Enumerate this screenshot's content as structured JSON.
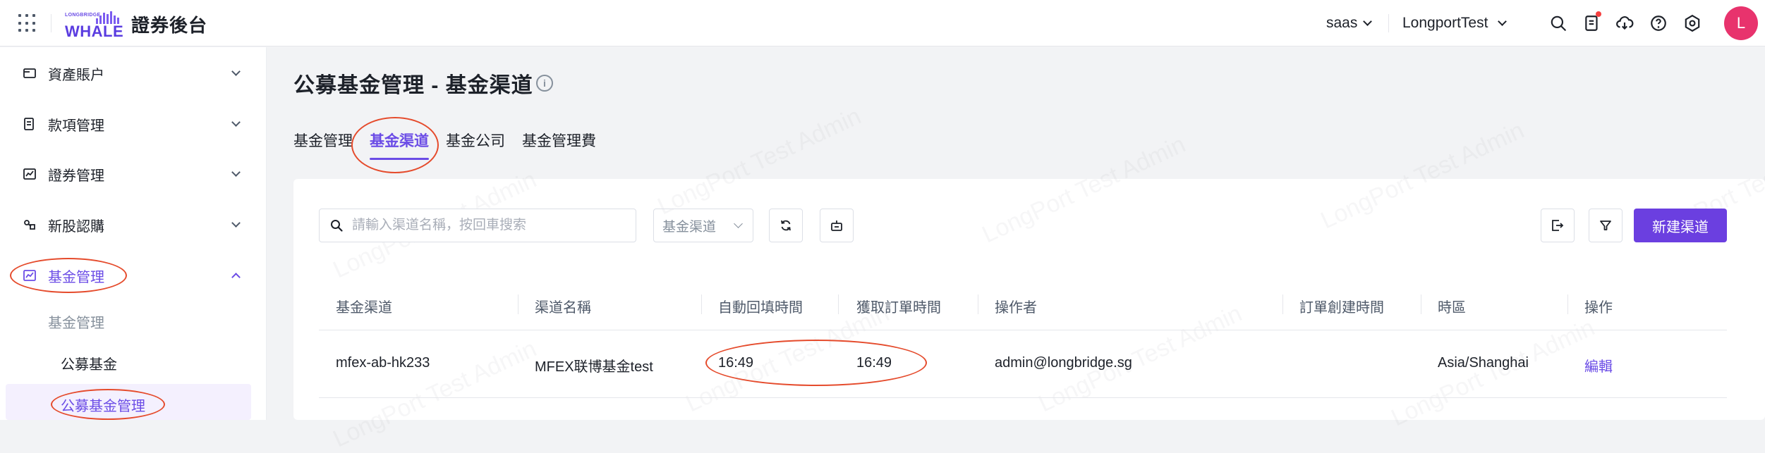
{
  "app": {
    "logo_small": "LONGBRIDGE",
    "logo_big": "WHALE",
    "title": "證券後台"
  },
  "topbar": {
    "env_label": "saas",
    "account_label": "LongportTest",
    "avatar_initial": "L"
  },
  "sidebar": {
    "items": [
      {
        "label": "資產賬户",
        "icon": "wallet-icon"
      },
      {
        "label": "款項管理",
        "icon": "document-icon"
      },
      {
        "label": "證券管理",
        "icon": "chart-icon"
      },
      {
        "label": "新股認購",
        "icon": "ipo-icon"
      },
      {
        "label": "基金管理",
        "icon": "fund-chart-icon"
      }
    ],
    "sub_group": "基金管理",
    "sub_items": [
      "公募基金",
      "公募基金管理"
    ]
  },
  "page": {
    "title": "公募基金管理 - 基金渠道",
    "tabs": [
      "基金管理",
      "基金渠道",
      "基金公司",
      "基金管理費"
    ],
    "active_tab": "基金渠道"
  },
  "toolbar": {
    "search_placeholder": "請輸入渠道名稱，按回車搜索",
    "select_value": "基金渠道",
    "new_button": "新建渠道"
  },
  "table": {
    "columns": [
      "基金渠道",
      "渠道名稱",
      "自動回填時間",
      "獲取訂單時間",
      "操作者",
      "訂單創建時間",
      "時區",
      "操作"
    ],
    "rows": [
      {
        "channel": "mfex-ab-hk233",
        "name": "MFEX联博基金test",
        "auto_fill_time": "16:49",
        "fetch_order_time": "16:49",
        "operator": "admin@longbridge.sg",
        "order_created_time": "",
        "timezone": "Asia/Shanghai",
        "action": "編輯"
      }
    ]
  },
  "watermark": "LongPort Test Admin",
  "colors": {
    "accent": "#6b4ce6",
    "primary_button": "#6b3fe0",
    "annotation": "#e54b2c",
    "avatar": "#e8336d"
  }
}
